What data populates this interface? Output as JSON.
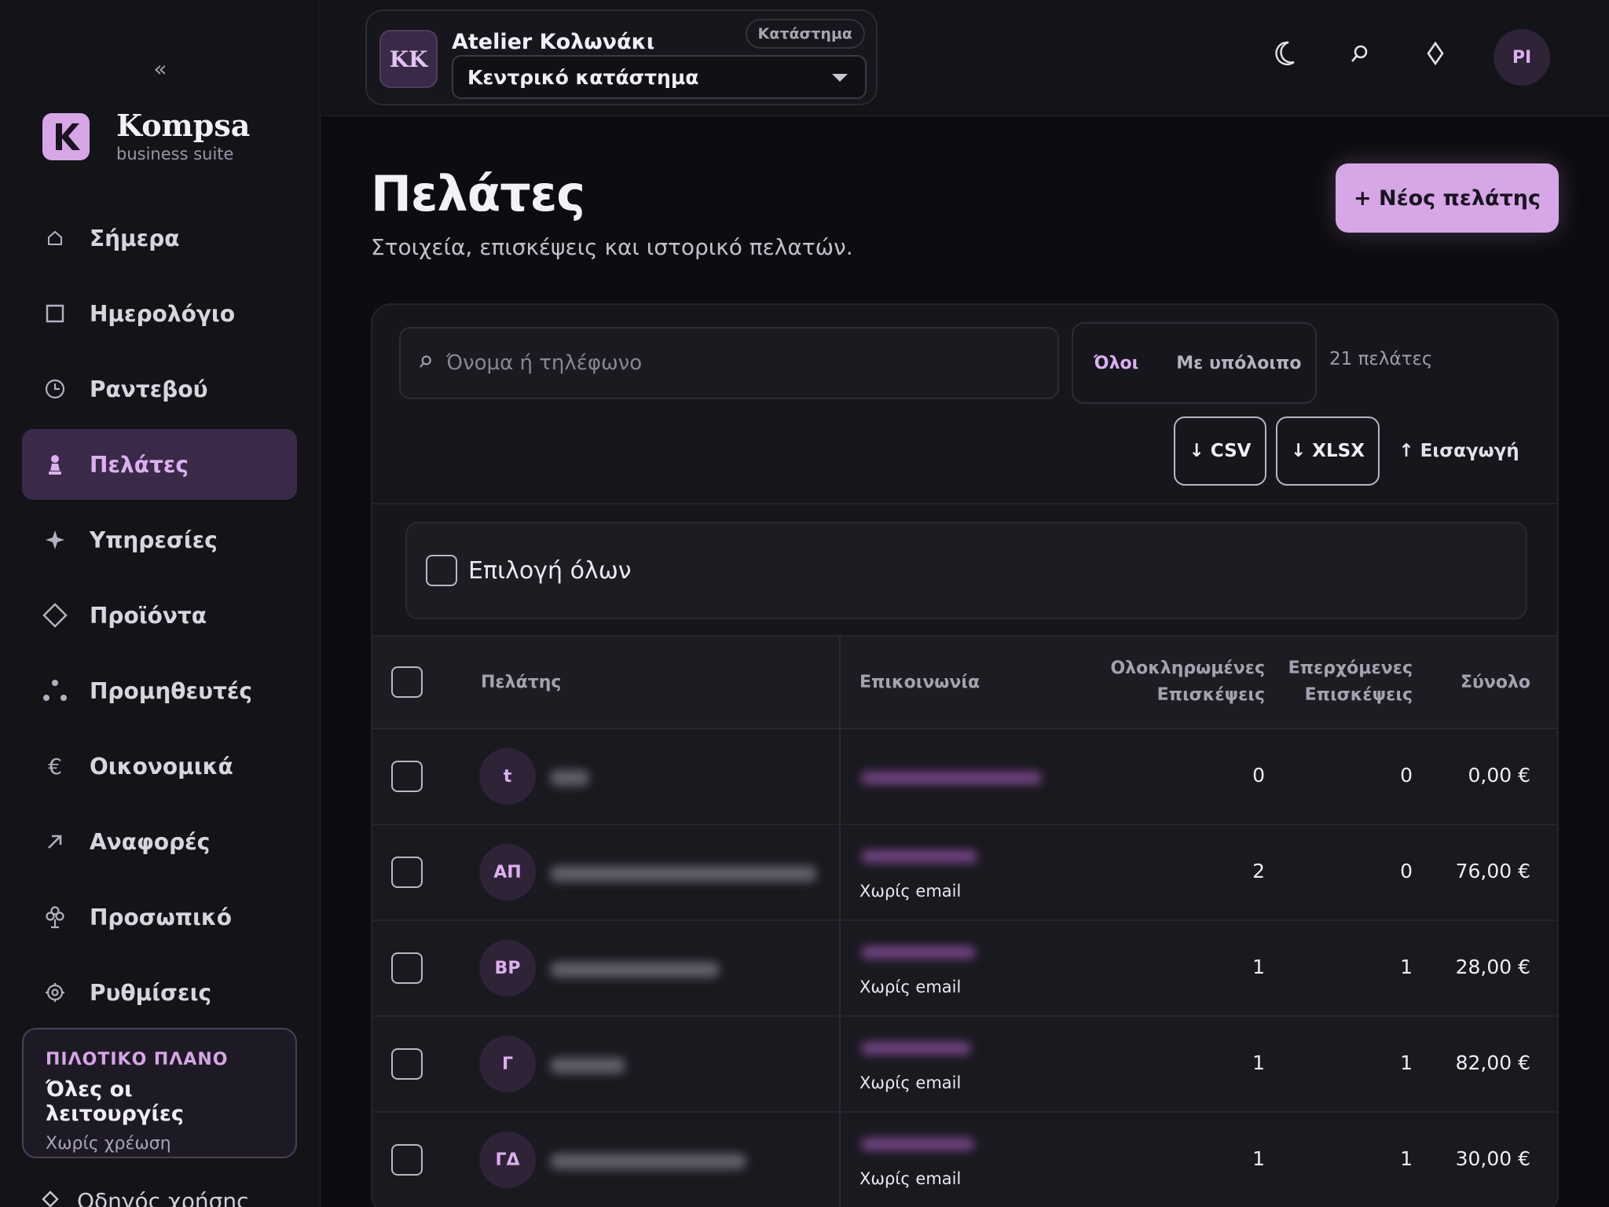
{
  "sidebar": {
    "collapse_label": "«",
    "brand": {
      "name": "Kompsa",
      "subtitle": "business suite"
    },
    "items": [
      {
        "label": "Σήμερα",
        "icon": "home-icon"
      },
      {
        "label": "Ημερολόγιο",
        "icon": "calendar-icon"
      },
      {
        "label": "Ραντεβού",
        "icon": "clock-icon"
      },
      {
        "label": "Πελάτες",
        "icon": "client-icon"
      },
      {
        "label": "Υπηρεσίες",
        "icon": "sparkle-icon"
      },
      {
        "label": "Προϊόντα",
        "icon": "diamond-icon"
      },
      {
        "label": "Προμηθευτές",
        "icon": "dots-icon"
      },
      {
        "label": "Οικονομικά",
        "icon": "euro-icon"
      },
      {
        "label": "Αναφορές",
        "icon": "arrow-up-right-icon"
      },
      {
        "label": "Προσωπικό",
        "icon": "staff-icon"
      },
      {
        "label": "Ρυθμίσεις",
        "icon": "gear-icon"
      }
    ],
    "plan": {
      "eyebrow": "ΠΙΛΟΤΙΚΟ ΠΛΑΝΟ",
      "title": "Όλες οι λειτουργίες",
      "subtitle": "Χωρίς χρέωση"
    },
    "help_label": "Οδηγός χρήσης"
  },
  "topbar": {
    "store": {
      "initials": "KK",
      "name": "Atelier Κολωνάκι",
      "badge": "Κατάστημα",
      "selected_location": "Κεντρικό κατάστημα"
    },
    "user_initials": "PI"
  },
  "page": {
    "title": "Πελάτες",
    "subtitle": "Στοιχεία, επισκέψεις και ιστορικό πελατών.",
    "new_button": "+ Νέος πελάτης"
  },
  "toolbar": {
    "search_placeholder": "Όνομα ή τηλέφωνο",
    "filter_all": "Όλοι",
    "filter_balance": "Με υπόλοιπο",
    "count_label": "21 πελάτες",
    "csv_label": "↓ CSV",
    "xlsx_label": "↓ XLSX",
    "import_label": "↑ Εισαγωγή"
  },
  "select_all_label": "Επιλογή όλων",
  "table": {
    "headers": {
      "client": "Πελάτης",
      "contact": "Επικοινωνία",
      "completed_1": "Ολοκληρωμένες",
      "completed_2": "Επισκέψεις",
      "upcoming_1": "Επερχόμενες",
      "upcoming_2": "Επισκέψεις",
      "total": "Σύνολο"
    },
    "rows": [
      {
        "initials": "t",
        "contact_note": "",
        "completed": "0",
        "upcoming": "0",
        "total": "0,00 €"
      },
      {
        "initials": "ΑΠ",
        "contact_note": "Χωρίς email",
        "completed": "2",
        "upcoming": "0",
        "total": "76,00 €"
      },
      {
        "initials": "ΒΡ",
        "contact_note": "Χωρίς email",
        "completed": "1",
        "upcoming": "1",
        "total": "28,00 €"
      },
      {
        "initials": "Γ",
        "contact_note": "Χωρίς email",
        "completed": "1",
        "upcoming": "1",
        "total": "82,00 €"
      },
      {
        "initials": "ΓΔ",
        "contact_note": "Χωρίς email",
        "completed": "1",
        "upcoming": "1",
        "total": "30,00 €"
      }
    ]
  },
  "colors": {
    "accent": "#d6a6e6",
    "background": "#0d0c10",
    "sidebar": "#141318",
    "active_nav": "#3a2a48"
  }
}
